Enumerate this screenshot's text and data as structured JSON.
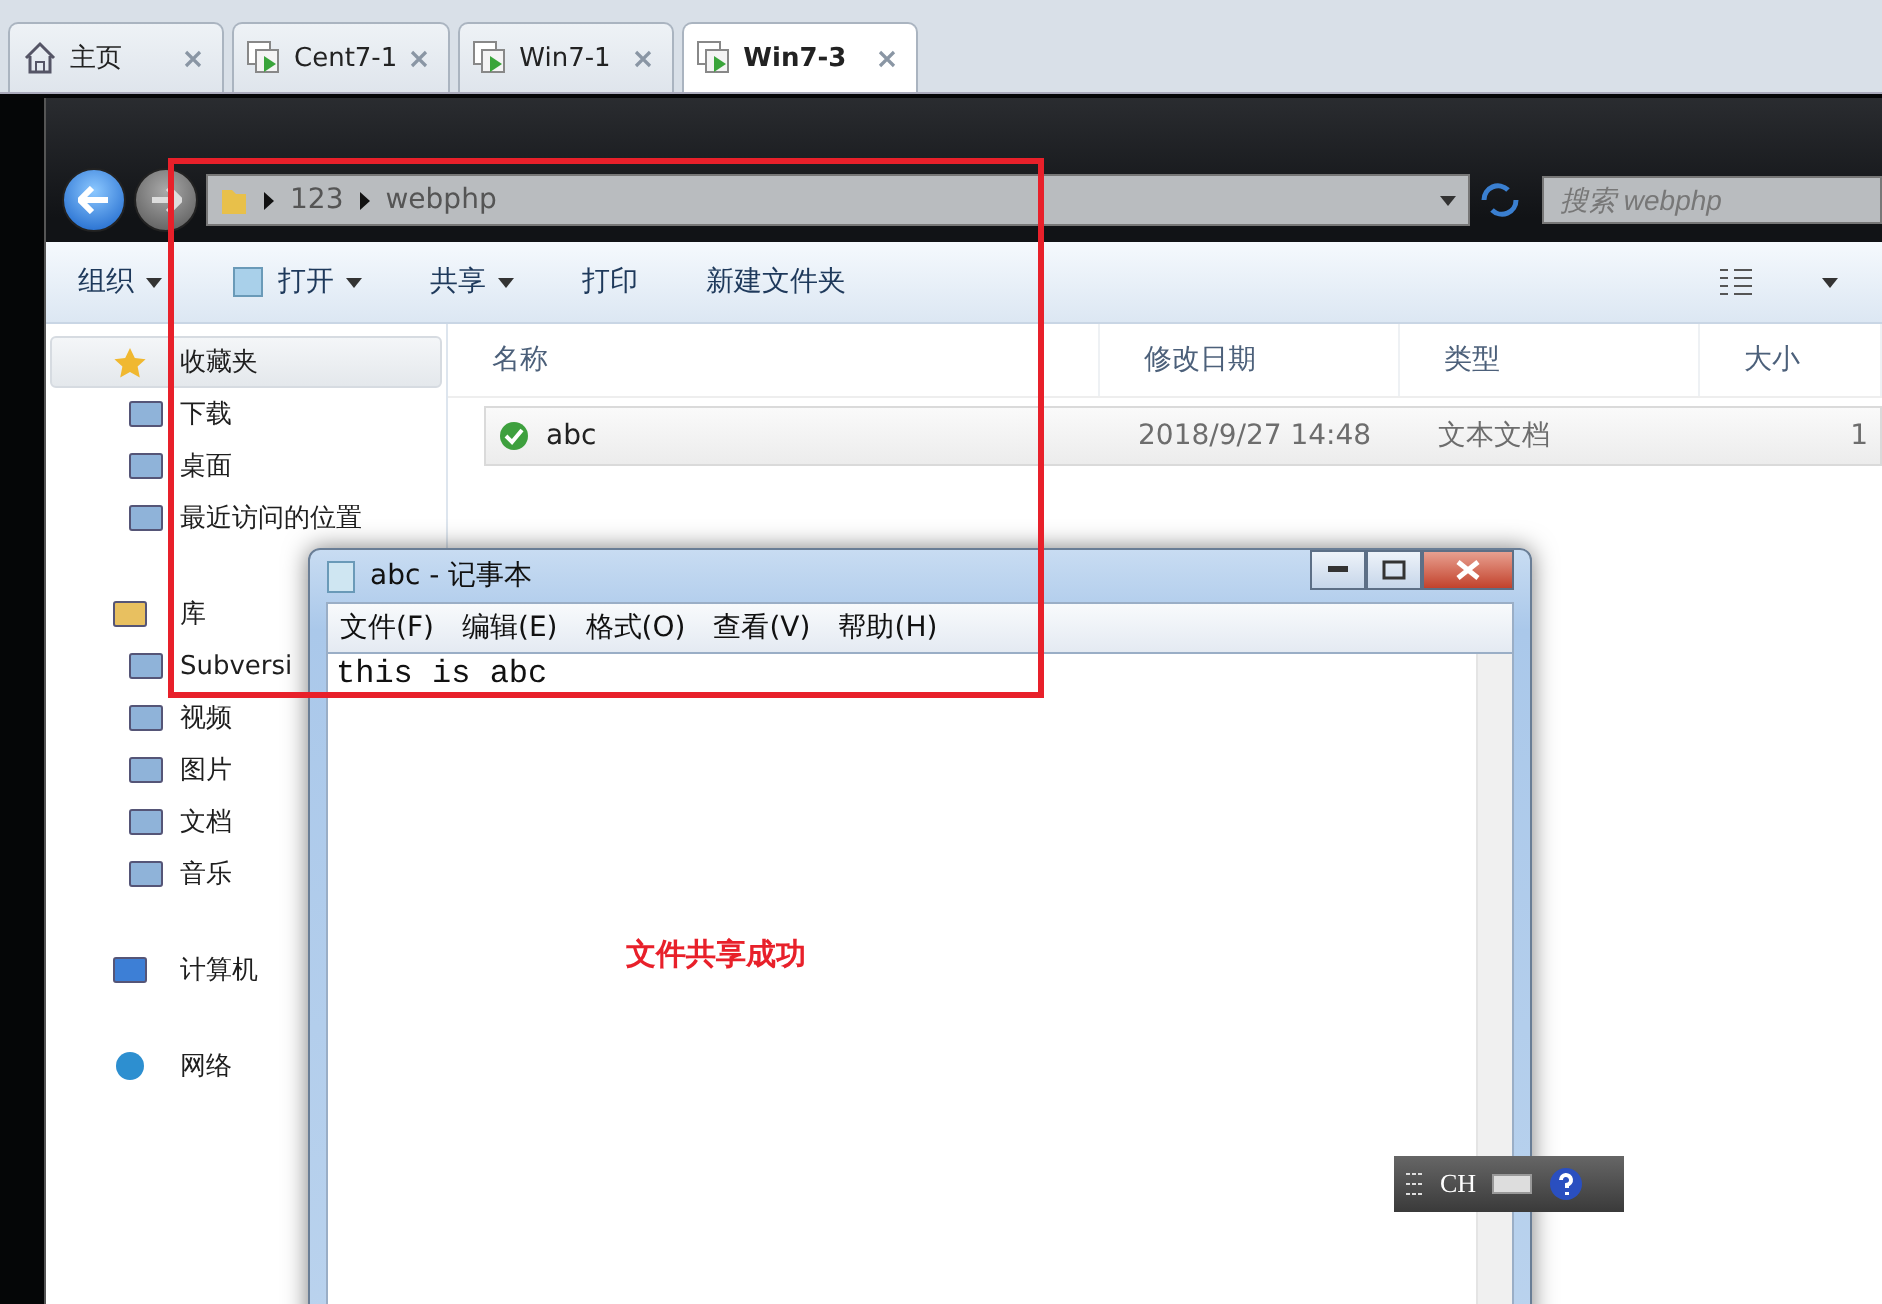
{
  "tabs": [
    {
      "label": "主页",
      "kind": "home",
      "selected": false
    },
    {
      "label": "Cent7-1",
      "kind": "vm",
      "selected": false
    },
    {
      "label": "Win7-1",
      "kind": "vm",
      "selected": false
    },
    {
      "label": "Win7-3",
      "kind": "vm",
      "selected": true
    }
  ],
  "explorer": {
    "breadcrumb": [
      "123",
      "webphp"
    ],
    "search": {
      "placeholder": "搜索 webphp"
    },
    "toolbar": [
      {
        "label": "组织",
        "has_menu": true
      },
      {
        "label": "打开",
        "has_menu": true
      },
      {
        "label": "共享",
        "has_menu": true
      },
      {
        "label": "打印",
        "has_menu": false
      },
      {
        "label": "新建文件夹",
        "has_menu": false
      }
    ],
    "sidebar": [
      {
        "label": "收藏夹",
        "selected": true,
        "children": [
          {
            "label": "下载",
            "selected": false
          },
          {
            "label": "桌面",
            "selected": false
          },
          {
            "label": "最近访问的位置",
            "selected": false
          }
        ]
      },
      {
        "label": "库",
        "selected": false,
        "children": [
          {
            "label": "Subversi",
            "selected": false
          },
          {
            "label": "视频",
            "selected": false
          },
          {
            "label": "图片",
            "selected": false
          },
          {
            "label": "文档",
            "selected": false
          },
          {
            "label": "音乐",
            "selected": false
          }
        ]
      },
      {
        "label": "计算机",
        "selected": false
      },
      {
        "label": "网络",
        "selected": false
      }
    ],
    "columns": [
      "名称",
      "修改日期",
      "类型",
      "大小"
    ],
    "rows": [
      {
        "cells": [
          "abc",
          "2018/9/27 14:48",
          "文本文档",
          "1"
        ],
        "selected": true
      }
    ]
  },
  "notepad": {
    "title": "abc - 记事本",
    "menu": [
      "文件(F)",
      "编辑(E)",
      "格式(O)",
      "查看(V)",
      "帮助(H)"
    ],
    "content": "this is abc"
  },
  "annotation": {
    "text": "文件共享成功"
  },
  "ime_bar": {
    "language": "CH"
  }
}
